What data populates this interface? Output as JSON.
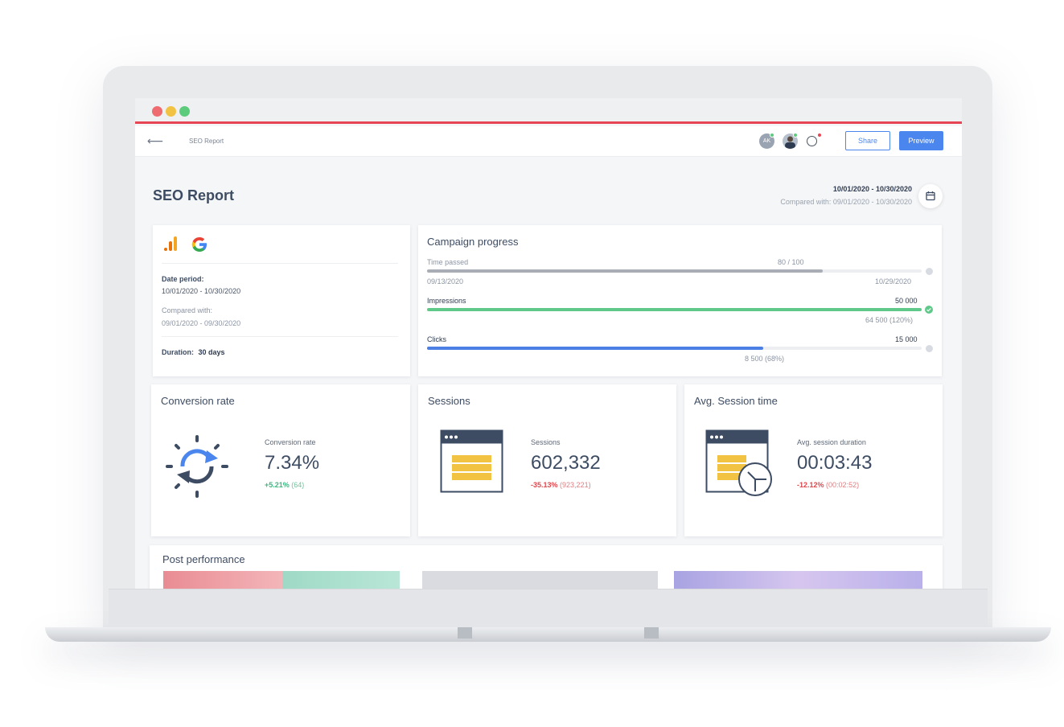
{
  "window": {
    "breadcrumb": "SEO Report"
  },
  "header": {
    "avatar_initials": "AK",
    "share_label": "Share",
    "preview_label": "Preview"
  },
  "report": {
    "title": "SEO Report",
    "date_range": "10/01/2020 - 10/30/2020",
    "compared": "Compared with: 09/01/2020 - 10/30/2020"
  },
  "info_card": {
    "date_period_label": "Date period:",
    "date_period_value": "10/01/2020 - 10/30/2020",
    "compared_label": "Compared with:",
    "compared_value": "09/01/2020 - 09/30/2020",
    "duration_label": "Duration:",
    "duration_value": "30 days"
  },
  "campaign": {
    "title": "Campaign progress",
    "time": {
      "label": "Time passed",
      "value": "80 / 100",
      "start": "09/13/2020",
      "end": "10/29/2020",
      "progress": 0.8
    },
    "impressions": {
      "label": "Impressions",
      "target": "50 000",
      "current": "64 500 (120%)",
      "progress": 1.0
    },
    "clicks": {
      "label": "Clicks",
      "target": "15 000",
      "current": "8 500 (68%)",
      "progress": 0.68
    }
  },
  "kpis": {
    "conversion": {
      "card_title": "Conversion rate",
      "label": "Conversion rate",
      "value": "7.34%",
      "change": "+5.21%",
      "prev": "(64)"
    },
    "sessions": {
      "card_title": "Sessions",
      "label": "Sessions",
      "value": "602,332",
      "change": "-35.13%",
      "prev": "(923,221)"
    },
    "avg_session": {
      "card_title": "Avg. Session time",
      "label": "Avg. session duration",
      "value": "00:03:43",
      "change": "-12.12%",
      "prev": "(00:02:52)"
    }
  },
  "post_performance": {
    "title": "Post performance"
  },
  "colors": {
    "accent": "#4b86ee",
    "brand_red": "#e64553",
    "positive": "#3bb77e",
    "negative": "#e0474c",
    "impressions_bar": "#5fc98a",
    "time_bar": "#a9aeb6",
    "clicks_bar": "#4b7fe4"
  }
}
